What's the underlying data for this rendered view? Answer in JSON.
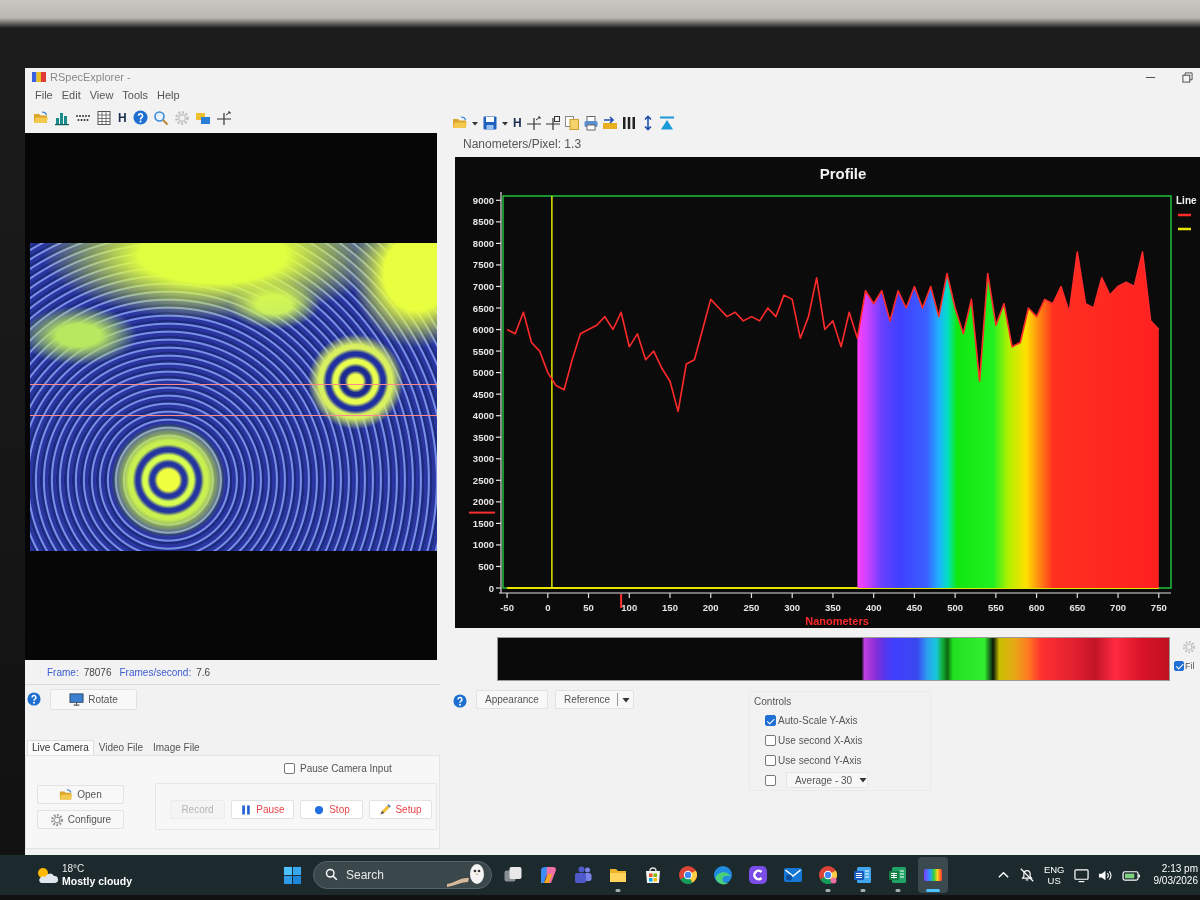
{
  "window": {
    "title": "RSpecExplorer -"
  },
  "menu": [
    "File",
    "Edit",
    "View",
    "Tools",
    "Help"
  ],
  "left_toolbar": {
    "text_button": "H"
  },
  "camera_status": {
    "frame_label": "Frame:",
    "frame": "78076",
    "fps_label": "Frames/second:",
    "fps": "7.6"
  },
  "rotate_button": "Rotate",
  "source_tabs": [
    {
      "label": "Live Camera",
      "selected": true
    },
    {
      "label": "Video File",
      "selected": false
    },
    {
      "label": "Image File",
      "selected": false
    }
  ],
  "pause_camera_input": {
    "label": "Pause Camera Input",
    "checked": false
  },
  "file_buttons": [
    "Open",
    "Configure"
  ],
  "record_buttons": [
    {
      "label": "Record",
      "disabled": true
    },
    {
      "label": "Pause",
      "disabled": false
    },
    {
      "label": "Stop",
      "disabled": false
    },
    {
      "label": "Setup",
      "disabled": false
    }
  ],
  "right_toolbar": {
    "text_button": "H"
  },
  "calibration": "Nanometers/Pixel: 1.3",
  "profile": {
    "legend_title": "Line",
    "chart_data": {
      "type": "line",
      "title": "Profile",
      "xlabel": "Nanometers",
      "x": [
        -50,
        -40,
        -30,
        -20,
        -10,
        0,
        10,
        20,
        30,
        40,
        50,
        60,
        70,
        80,
        90,
        100,
        110,
        120,
        130,
        140,
        150,
        160,
        170,
        180,
        190,
        200,
        210,
        220,
        230,
        240,
        250,
        260,
        270,
        280,
        290,
        300,
        310,
        320,
        330,
        340,
        350,
        360,
        370,
        380,
        390,
        400,
        410,
        420,
        430,
        440,
        450,
        460,
        470,
        480,
        490,
        500,
        510,
        520,
        530,
        540,
        550,
        560,
        570,
        580,
        590,
        600,
        610,
        620,
        630,
        640,
        650,
        660,
        670,
        680,
        690,
        700,
        710,
        720,
        730,
        740,
        750
      ],
      "series": [
        {
          "color": "#ff2a2a",
          "values": [
            6000,
            5900,
            6400,
            5700,
            5500,
            5000,
            4700,
            4600,
            5300,
            5900,
            6000,
            6100,
            6300,
            6000,
            6400,
            5600,
            5900,
            5300,
            5500,
            5100,
            4800,
            4100,
            5200,
            5300,
            6000,
            6700,
            6500,
            6300,
            6400,
            6200,
            6300,
            6200,
            6500,
            6300,
            6800,
            6700,
            5800,
            6300,
            7200,
            6000,
            6200,
            5600,
            6400,
            5800,
            6900,
            6600,
            6900,
            6200,
            6900,
            6500,
            7000,
            6500,
            7000,
            6300,
            7300,
            6500,
            5900,
            6700,
            4800,
            7300,
            6100,
            6600,
            5600,
            5700,
            6500,
            6300,
            6700,
            6600,
            7000,
            6400,
            7800,
            6600,
            6500,
            7200,
            6800,
            7000,
            7100,
            7000,
            7800,
            6200,
            6000
          ]
        },
        {
          "color": "#e6e600",
          "values": [
            0,
            0,
            0,
            0,
            0,
            0,
            0,
            0,
            0,
            0,
            0,
            0,
            0,
            0,
            0,
            0,
            0,
            0,
            0,
            0,
            0,
            0,
            0,
            0,
            0,
            0,
            0,
            0,
            0,
            0,
            0,
            0,
            0,
            0,
            0,
            0,
            0,
            0,
            0,
            0,
            0,
            0,
            0,
            0,
            0,
            0,
            0,
            0,
            0,
            0,
            0,
            0,
            0,
            0,
            0,
            0,
            0,
            0,
            0,
            0,
            0,
            0,
            0,
            0,
            0,
            0,
            0,
            0,
            0,
            0,
            0,
            0,
            0,
            0,
            0,
            0,
            0,
            0,
            0,
            0,
            0
          ]
        }
      ],
      "xlim": [
        -55,
        765
      ],
      "ylim": [
        0,
        9100
      ],
      "xticks": [
        -50,
        0,
        50,
        100,
        150,
        200,
        250,
        300,
        350,
        400,
        450,
        500,
        550,
        600,
        650,
        700,
        750
      ],
      "yticks": [
        0,
        500,
        1000,
        1500,
        2000,
        2500,
        3000,
        3500,
        4000,
        4500,
        5000,
        5500,
        6000,
        6500,
        7000,
        7500,
        8000,
        8500,
        9000
      ],
      "ref_lines": [
        {
          "axis": "x",
          "value": 5,
          "color": "#e6e600"
        }
      ]
    }
  },
  "fill_checkbox": {
    "label": "Fil",
    "checked": true
  },
  "buttons": [
    {
      "label": "Appearance",
      "dropdown": false
    },
    {
      "label": "Reference",
      "dropdown": true
    }
  ],
  "controls": {
    "title": "Controls",
    "options": [
      {
        "label": "Auto-Scale Y-Axis",
        "checked": true
      },
      {
        "label": "Use second X-Axis",
        "checked": false
      },
      {
        "label": "Use second Y-Axis",
        "checked": false
      }
    ],
    "average": {
      "checked": false,
      "value": "Average - 30"
    }
  },
  "taskbar": {
    "weather": {
      "temperature": "18°C",
      "condition": "Mostly cloudy"
    },
    "search": {
      "placeholder": "Search"
    },
    "apps": [
      {
        "running": false,
        "active": false
      },
      {
        "running": false,
        "active": false
      },
      {
        "running": false,
        "active": false
      },
      {
        "running": true,
        "active": false
      },
      {
        "running": false,
        "active": false
      },
      {
        "running": false,
        "active": false
      },
      {
        "running": false,
        "active": false
      },
      {
        "running": false,
        "active": false
      },
      {
        "running": false,
        "active": false
      },
      {
        "running": true,
        "active": false
      },
      {
        "running": true,
        "active": false
      },
      {
        "running": true,
        "active": false
      },
      {
        "running": true,
        "active": true
      }
    ],
    "language": {
      "primary": "ENG",
      "secondary": "US"
    },
    "time": "2:13 pm",
    "date": "9/03/2026"
  }
}
